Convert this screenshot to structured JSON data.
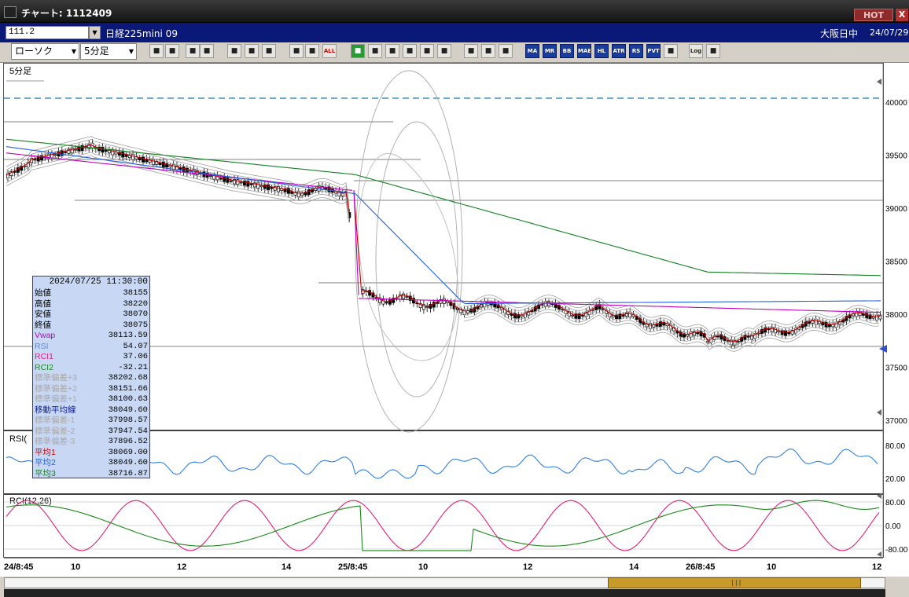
{
  "window": {
    "title": "チャート: 1112409",
    "hot_label": "HOT",
    "close_label": "X"
  },
  "symbol": {
    "code": "111.2",
    "name": "日経225mini 09",
    "market": "大阪日中",
    "date": "24/07/29"
  },
  "toolbar": {
    "chart_type": "ローソク",
    "interval": "5分足",
    "buttons": [
      "zoom-icon",
      "crosshair-icon",
      "cursor-icon",
      "search-icon",
      "bar-icon",
      "arrows-icon",
      "reset-icon",
      "candle-icon",
      "candle2-icon",
      "ALL",
      "pen-icon",
      "line-icon",
      "pointer-icon",
      "undo-icon",
      "list-icon",
      "trash-icon",
      "shape-icon",
      "wrench-icon",
      "color-icon",
      "MA",
      "MR",
      "BB",
      "MAE",
      "HL",
      "ATR",
      "RS",
      "PVT",
      "box-icon",
      "Log",
      "window-icon"
    ]
  },
  "chart": {
    "panel_label": "5分足",
    "price_axis": [
      "40000",
      "39500",
      "39000",
      "38500",
      "38000",
      "37500",
      "37000"
    ],
    "rsi_title": "RSI(",
    "rsi_axis": [
      "80.00",
      "20.00"
    ],
    "rci_title": "RCI(12,26)",
    "rci_axis": [
      "80.00",
      "0.00",
      "-80.00"
    ],
    "time_axis": [
      "24/8:45",
      "10",
      "12",
      "14",
      "25/8:45",
      "10",
      "12",
      "14",
      "26/8:45",
      "10",
      "12"
    ],
    "colors": {
      "candle": "#000000",
      "vwap": "#c000c0",
      "ma1": "#d00000",
      "ma2": "#2060e0",
      "ma3": "#108020",
      "band": "#a0a0a0",
      "level": "#444444",
      "dashed_level": "#1a7ab0",
      "rsi": "#3080e0",
      "rci1": "#e0207a",
      "rci2": "#1a8a1a"
    }
  },
  "info": {
    "timestamp": "2024/07/25  11:30:00",
    "rows": [
      {
        "label": "始値",
        "value": "38155",
        "color": "#000000"
      },
      {
        "label": "高値",
        "value": "38220",
        "color": "#000000"
      },
      {
        "label": "安値",
        "value": "38070",
        "color": "#000000"
      },
      {
        "label": "終値",
        "value": "38075",
        "color": "#000000"
      },
      {
        "label": "Vwap",
        "value": "38113.59",
        "color": "#c000c0"
      },
      {
        "label": "RSI",
        "value": "54.07",
        "color": "#5a8ae0"
      },
      {
        "label": "RCI1",
        "value": "37.06",
        "color": "#e0207a"
      },
      {
        "label": "RCI2",
        "value": "-32.21",
        "color": "#1a8a1a"
      },
      {
        "label": "標準偏差+3",
        "value": "38202.68",
        "color": "#a8a8a8"
      },
      {
        "label": "標準偏差+2",
        "value": "38151.66",
        "color": "#a8a8a8"
      },
      {
        "label": "標準偏差+1",
        "value": "38100.63",
        "color": "#a8a8a8"
      },
      {
        "label": "移動平均線",
        "value": "38049.60",
        "color": "#0a1aa0"
      },
      {
        "label": "標準偏差-1",
        "value": "37998.57",
        "color": "#a8a8a8"
      },
      {
        "label": "標準偏差-2",
        "value": "37947.54",
        "color": "#a8a8a8"
      },
      {
        "label": "標準偏差-3",
        "value": "37896.52",
        "color": "#a8a8a8"
      },
      {
        "label": "平均1",
        "value": "38069.00",
        "color": "#d00000"
      },
      {
        "label": "平均2",
        "value": "38049.60",
        "color": "#2060e0"
      },
      {
        "label": "平均3",
        "value": "38716.87",
        "color": "#108020"
      }
    ]
  }
}
